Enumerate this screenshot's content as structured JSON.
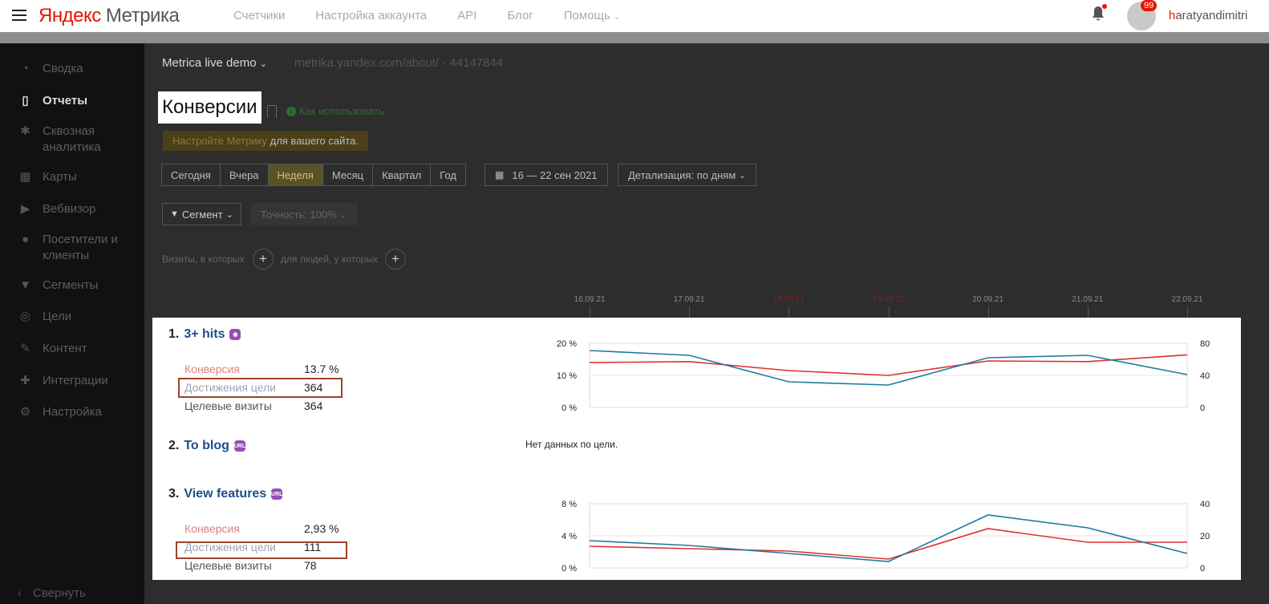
{
  "header": {
    "logo_brand": "Яндекс",
    "logo_product": "Метрика",
    "nav": [
      "Счетчики",
      "Настройка аккаунта",
      "API",
      "Блог",
      "Помощь"
    ],
    "notification_count": "99",
    "username_first": "h",
    "username_rest": "aratyandimitri"
  },
  "sidebar": {
    "items": [
      {
        "label": "Сводка",
        "icon": "gauge-icon"
      },
      {
        "label": "Отчеты",
        "icon": "bar-chart-icon"
      },
      {
        "label": "Сквозная аналитика",
        "icon": "asterisk-icon"
      },
      {
        "label": "Карты",
        "icon": "map-icon"
      },
      {
        "label": "Вебвизор",
        "icon": "play-icon"
      },
      {
        "label": "Посетители и клиенты",
        "icon": "person-icon"
      },
      {
        "label": "Сегменты",
        "icon": "funnel-icon"
      },
      {
        "label": "Цели",
        "icon": "target-icon"
      },
      {
        "label": "Контент",
        "icon": "pen-icon"
      },
      {
        "label": "Интеграции",
        "icon": "puzzle-icon"
      },
      {
        "label": "Настройка",
        "icon": "gear-icon"
      }
    ],
    "collapse_label": "Свернуть"
  },
  "main": {
    "counter_name": "Metrica live demo",
    "counter_url": "metrika.yandex.com/about/ · 44147844",
    "page_title": "Конверсии",
    "howto_label": "Как использовать",
    "warning_link": "Настройте Метрику",
    "warning_text": " для вашего сайта.",
    "periods": [
      "Сегодня",
      "Вчера",
      "Неделя",
      "Месяц",
      "Квартал",
      "Год"
    ],
    "selected_period": "Неделя",
    "date_range": "16 — 22 сен 2021",
    "detail_label": "Детализация: по дням",
    "segment_label": "Сегмент",
    "accuracy_label": "Точность: 100%",
    "cond_visits": "Визиты, в которых",
    "cond_people": "для людей, у которых",
    "dates": [
      "16.09.21",
      "17.09.21",
      "18.09.21",
      "19.09.21",
      "20.09.21",
      "21.09.21",
      "22.09.21"
    ],
    "weekend_dates": [
      "18.09.21",
      "19.09.21"
    ]
  },
  "goals": [
    {
      "number": "1.",
      "name": "3+ hits",
      "tag_icon": "views-goal-icon",
      "conversion_label": "Конверсия",
      "conversion": "13.7 %",
      "reaches_label": "Достижения цели",
      "reaches": "364",
      "visits_label": "Целевые визиты",
      "visits": "364"
    },
    {
      "number": "2.",
      "name": "To blog",
      "tag_icon": "url-goal-icon",
      "no_data": "Нет данных по цели."
    },
    {
      "number": "3.",
      "name": "View features",
      "tag_icon": "url-goal-icon",
      "conversion_label": "Конверсия",
      "conversion": "2,93 %",
      "reaches_label": "Достижения цели",
      "reaches": "111",
      "visits_label": "Целевые визиты",
      "visits": "78"
    }
  ],
  "colors": {
    "conversion_line": "#e03030",
    "visits_line": "#1f7aa0",
    "highlight_border": "#a0422a",
    "brand_red": "#e61400"
  },
  "chart_data": [
    {
      "type": "line",
      "goal": "3+ hits",
      "x": [
        "16.09.21",
        "17.09.21",
        "18.09.21",
        "19.09.21",
        "20.09.21",
        "21.09.21",
        "22.09.21"
      ],
      "left_ticks": [
        "0 %",
        "10 %",
        "20 %"
      ],
      "right_ticks": [
        "0",
        "40",
        "80"
      ],
      "ylim_left": [
        0,
        20
      ],
      "ylim_right": [
        0,
        80
      ],
      "series": [
        {
          "axis": "left",
          "color": "#e03030",
          "values": [
            14,
            14.3,
            11.5,
            10,
            14.5,
            14.3,
            16.4
          ]
        },
        {
          "axis": "right",
          "color": "#1f7aa0",
          "values": [
            71,
            65,
            32,
            28,
            62,
            65,
            41
          ]
        }
      ]
    },
    {
      "type": "line",
      "goal": "View features",
      "x": [
        "16.09.21",
        "17.09.21",
        "18.09.21",
        "19.09.21",
        "20.09.21",
        "21.09.21",
        "22.09.21"
      ],
      "left_ticks": [
        "0 %",
        "4 %",
        "8 %"
      ],
      "right_ticks": [
        "0",
        "20",
        "40"
      ],
      "ylim_left": [
        0,
        8
      ],
      "ylim_right": [
        0,
        40
      ],
      "series": [
        {
          "axis": "left",
          "color": "#e03030",
          "values": [
            2.7,
            2.4,
            2.1,
            1.1,
            4.9,
            3.2,
            3.2
          ]
        },
        {
          "axis": "right",
          "color": "#1f7aa0",
          "values": [
            17,
            14,
            9,
            4,
            33,
            25,
            9
          ]
        }
      ]
    }
  ]
}
